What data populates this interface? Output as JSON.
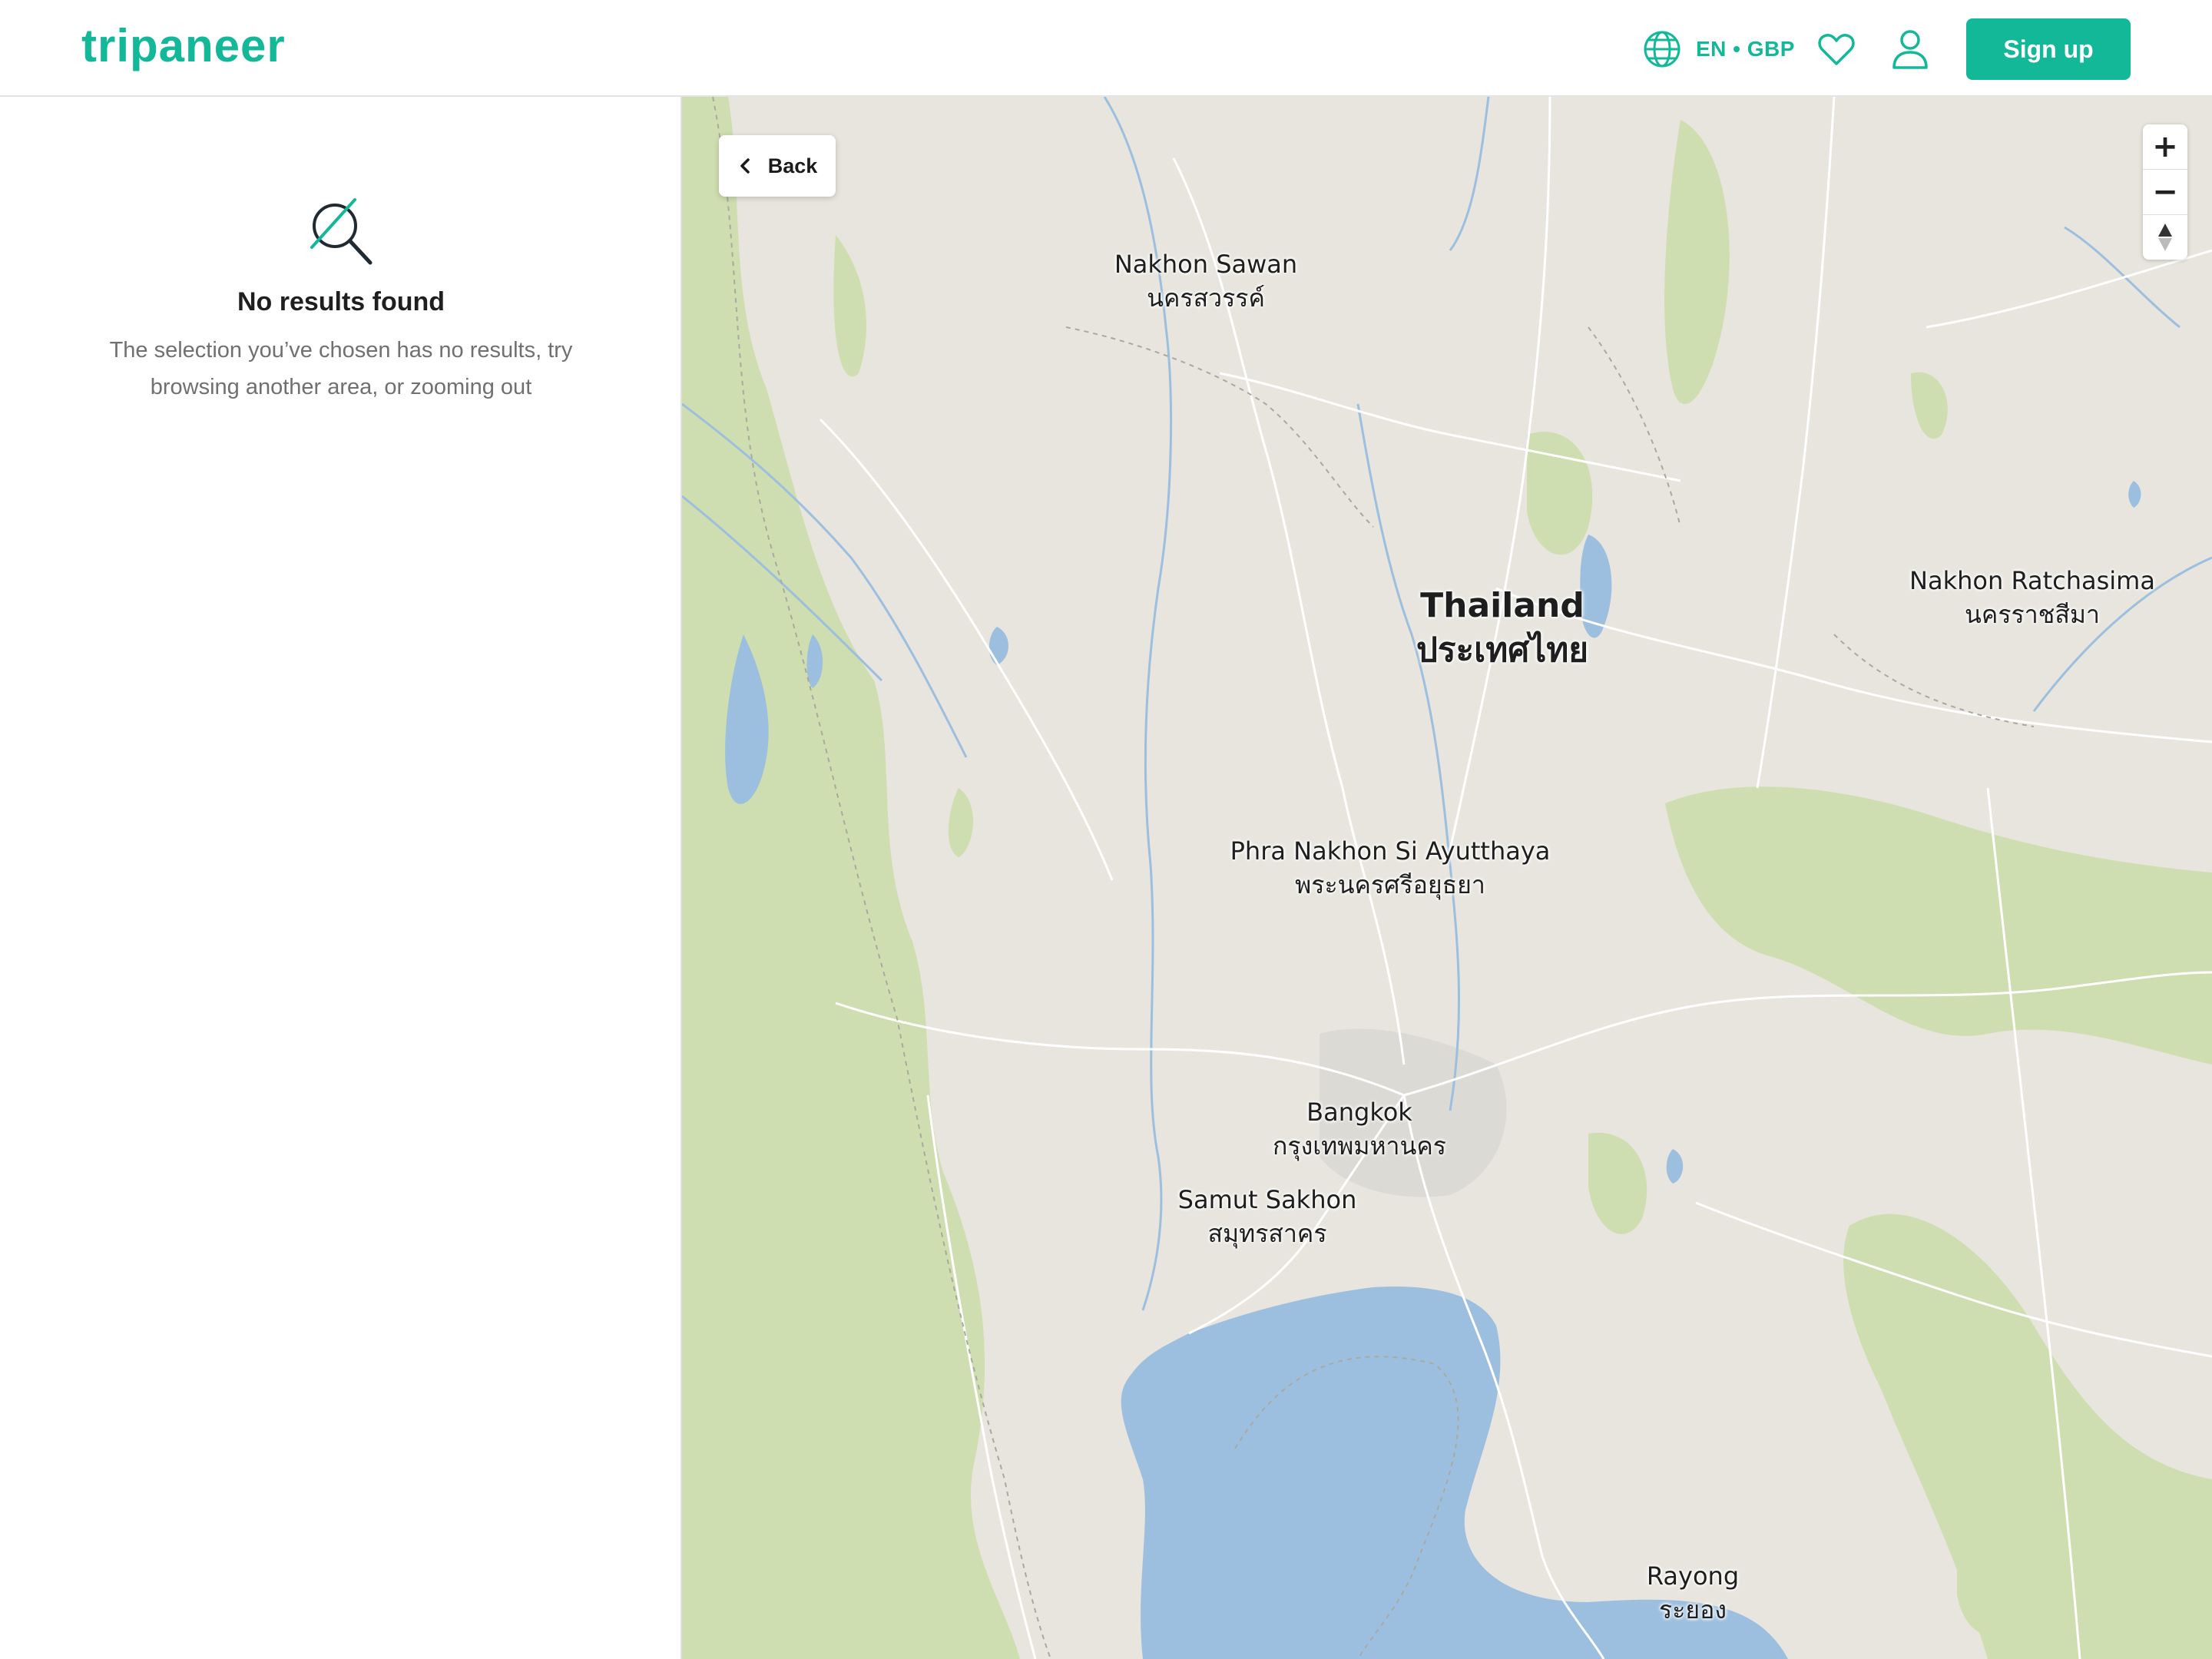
{
  "header": {
    "logo": "tripaneer",
    "language_currency": "EN • GBP",
    "signup_label": "Sign up"
  },
  "results": {
    "title": "No results found",
    "message": "The selection you’ve chosen has no results, try browsing another area, or zooming out"
  },
  "map": {
    "back_label": "Back",
    "zoom_in": "+",
    "zoom_out": "−",
    "compass": "▲",
    "labels": [
      {
        "name": "Nakhon Sawan",
        "local": "นครสวรรค์"
      },
      {
        "name": "Thailand",
        "local": "ประเทศไทย"
      },
      {
        "name": "Nakhon Ratchasima",
        "local": "นครราชสีมา"
      },
      {
        "name": "Phra Nakhon Si Ayutthaya",
        "local": "พระนครศรีอยุธยา"
      },
      {
        "name": "Bangkok",
        "local": "กรุงเทพมหานคร"
      },
      {
        "name": "Samut Sakhon",
        "local": "สมุทรสาคร"
      },
      {
        "name": "Rayong",
        "local": "ระยอง"
      }
    ]
  },
  "colors": {
    "brand": "#13b898",
    "land": "#e7e5dd",
    "forest": "#cfdeb0",
    "water": "#9dbfdf"
  }
}
